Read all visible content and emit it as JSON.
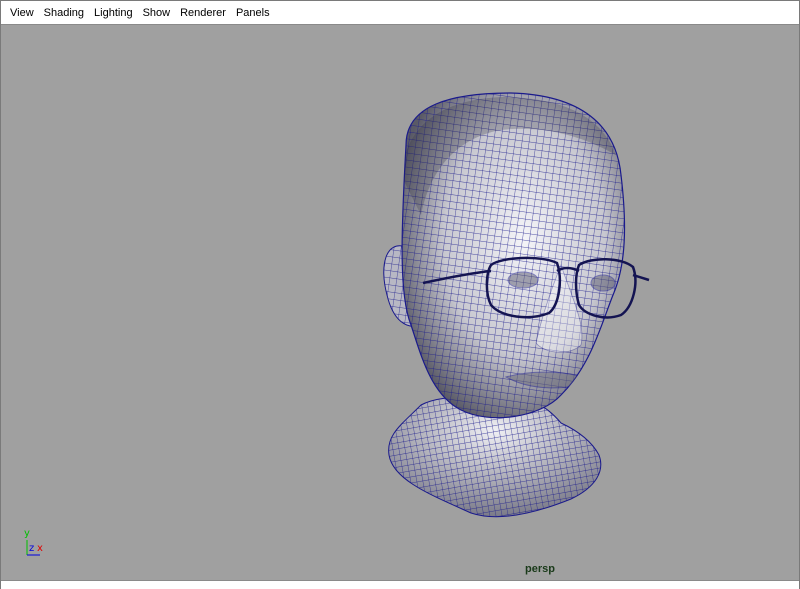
{
  "menu": {
    "items": [
      "View",
      "Shading",
      "Lighting",
      "Show",
      "Renderer",
      "Panels"
    ]
  },
  "viewport": {
    "camera_label": "persp",
    "axis": {
      "y": "y",
      "z": "z",
      "x": "x"
    }
  },
  "colors": {
    "viewport_bg": "#a0a0a0",
    "wire": "#1a1a8c",
    "axis_x": "#e00000",
    "axis_y": "#00c000",
    "axis_z": "#0000e0",
    "camera_label": "#1a3a1a"
  },
  "icons": {
    "axis": "axis-gizmo-icon"
  }
}
